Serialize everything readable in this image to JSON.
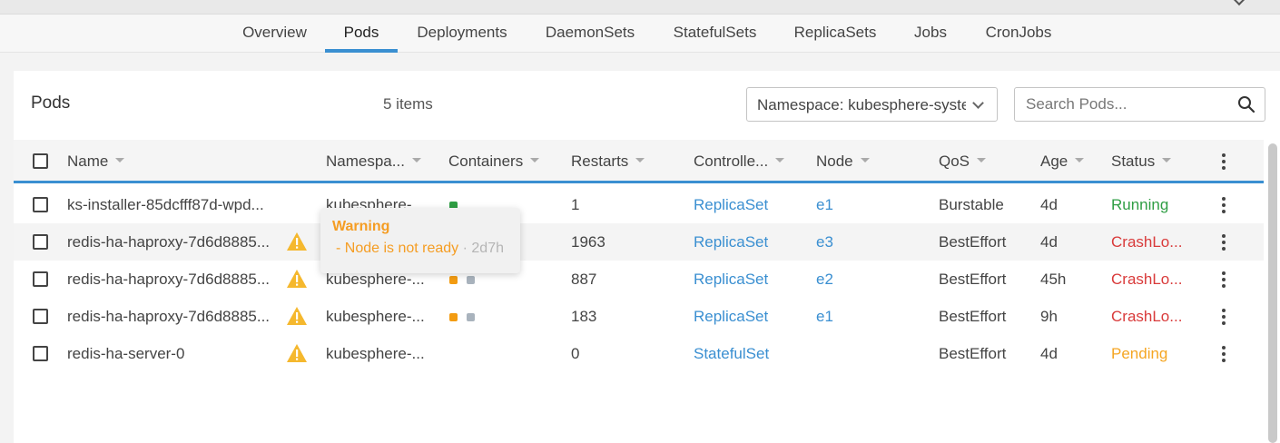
{
  "tabs": [
    {
      "label": "Overview"
    },
    {
      "label": "Pods",
      "active": true
    },
    {
      "label": "Deployments"
    },
    {
      "label": "DaemonSets"
    },
    {
      "label": "StatefulSets"
    },
    {
      "label": "ReplicaSets"
    },
    {
      "label": "Jobs"
    },
    {
      "label": "CronJobs"
    }
  ],
  "panel": {
    "title": "Pods",
    "count": "5 items",
    "namespace_select": "Namespace: kubesphere-system",
    "search_placeholder": "Search Pods..."
  },
  "table": {
    "columns": [
      "Name",
      "Namespa...",
      "Containers",
      "Restarts",
      "Controlle...",
      "Node",
      "QoS",
      "Age",
      "Status"
    ],
    "rows": [
      {
        "name": "ks-installer-85dcfff87d-wpd...",
        "namespace": "kubesphere-",
        "warning": false,
        "containers": [
          "ready"
        ],
        "restarts": "1",
        "controller": "ReplicaSet",
        "node": "e1",
        "qos": "Burstable",
        "age": "4d",
        "status": "Running"
      },
      {
        "name": "redis-ha-haproxy-7d6d8885...",
        "namespace": "",
        "warning": true,
        "containers": [],
        "restarts": "1963",
        "controller": "ReplicaSet",
        "node": "e3",
        "qos": "BestEffort",
        "age": "4d",
        "status": "CrashLo..."
      },
      {
        "name": "redis-ha-haproxy-7d6d8885...",
        "namespace": "kubesphere-...",
        "warning": true,
        "containers": [
          "warning",
          "waiting"
        ],
        "restarts": "887",
        "controller": "ReplicaSet",
        "node": "e2",
        "qos": "BestEffort",
        "age": "45h",
        "status": "CrashLo..."
      },
      {
        "name": "redis-ha-haproxy-7d6d8885...",
        "namespace": "kubesphere-...",
        "warning": true,
        "containers": [
          "warning",
          "waiting"
        ],
        "restarts": "183",
        "controller": "ReplicaSet",
        "node": "e1",
        "qos": "BestEffort",
        "age": "9h",
        "status": "CrashLo..."
      },
      {
        "name": "redis-ha-server-0",
        "namespace": "kubesphere-...",
        "warning": true,
        "containers": [],
        "restarts": "0",
        "controller": "StatefulSet",
        "node": "",
        "qos": "BestEffort",
        "age": "4d",
        "status": "Pending"
      }
    ]
  },
  "tooltip": {
    "title": "Warning",
    "message": "- Node is not ready",
    "separator": " · ",
    "time": "2d7h"
  },
  "colors": {
    "accent": "#3a8fd1",
    "running": "#2f9e44",
    "crash": "#d93a3a",
    "pending": "#f5a623",
    "container_ready": "#2f9e44",
    "container_warning": "#f39c12",
    "container_waiting": "#a9b3bd"
  }
}
